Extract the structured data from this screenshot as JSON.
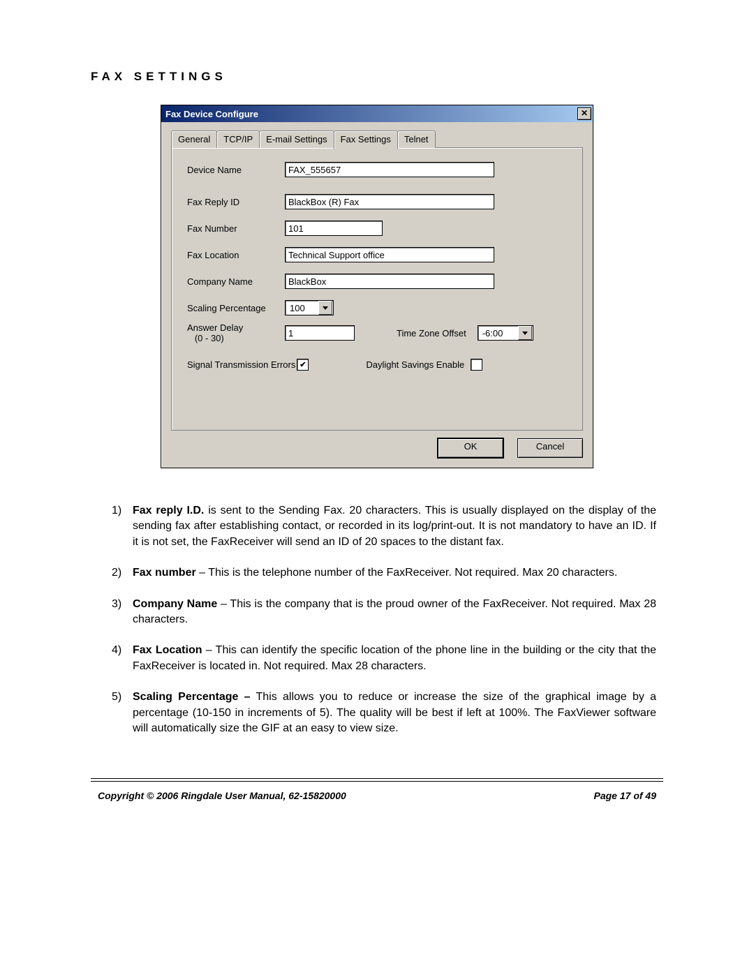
{
  "heading": "FAX SETTINGS",
  "dialog": {
    "title": "Fax Device Configure",
    "tabs": [
      "General",
      "TCP/IP",
      "E-mail Settings",
      "Fax Settings",
      "Telnet"
    ],
    "activeTab": 3,
    "fields": {
      "deviceName": {
        "label": "Device Name",
        "value": "FAX_555657"
      },
      "faxReplyId": {
        "label": "Fax Reply ID",
        "value": "BlackBox (R) Fax"
      },
      "faxNumber": {
        "label": "Fax Number",
        "value": "101"
      },
      "faxLocation": {
        "label": "Fax Location",
        "value": "Technical Support office"
      },
      "companyName": {
        "label": "Company Name",
        "value": "BlackBox"
      },
      "scalingPct": {
        "label": "Scaling Percentage",
        "value": "100"
      },
      "answerDelay": {
        "label": "Answer Delay",
        "sublabel": "(0 - 30)",
        "value": "1"
      },
      "tzOffset": {
        "label": "Time Zone Offset",
        "value": "-6:00"
      },
      "signalErrors": {
        "label": "Signal Transmission Errors",
        "checked": true
      },
      "dst": {
        "label": "Daylight Savings Enable",
        "checked": false
      }
    },
    "buttons": {
      "ok": "OK",
      "cancel": "Cancel"
    }
  },
  "descriptions": [
    {
      "num": "1)",
      "bold": "Fax reply I.D.",
      "text": " is sent to the Sending Fax. 20 characters.  This is usually displayed on the display of the sending fax after establishing contact, or recorded in its log/print-out. It is not mandatory to have an ID.  If it is not set, the FaxReceiver will send an ID of 20 spaces to the distant fax."
    },
    {
      "num": "2)",
      "bold": "Fax number",
      "text": "  – This is the telephone number of the FaxReceiver. Not required. Max 20 characters."
    },
    {
      "num": "3)",
      "bold": "Company Name",
      "text": "  – This is the company that is the proud owner of the FaxReceiver. Not required. Max 28 characters."
    },
    {
      "num": "4)",
      "bold": "Fax Location",
      "text": "  – This can identify the specific location of the phone line in the building or the city that the FaxReceiver is located in. Not required. Max 28 characters."
    },
    {
      "num": "5)",
      "bold": "Scaling Percentage –",
      "text": " This allows you to reduce or increase the size of the graphical image by a percentage (10-150 in increments of 5). The quality will be best if left at 100%. The FaxViewer software will automatically size the GIF at an easy to view size."
    }
  ],
  "footer": {
    "left": "Copyright © 2006 Ringdale   User Manual, 62-15820000",
    "right": "Page 17 of 49"
  }
}
